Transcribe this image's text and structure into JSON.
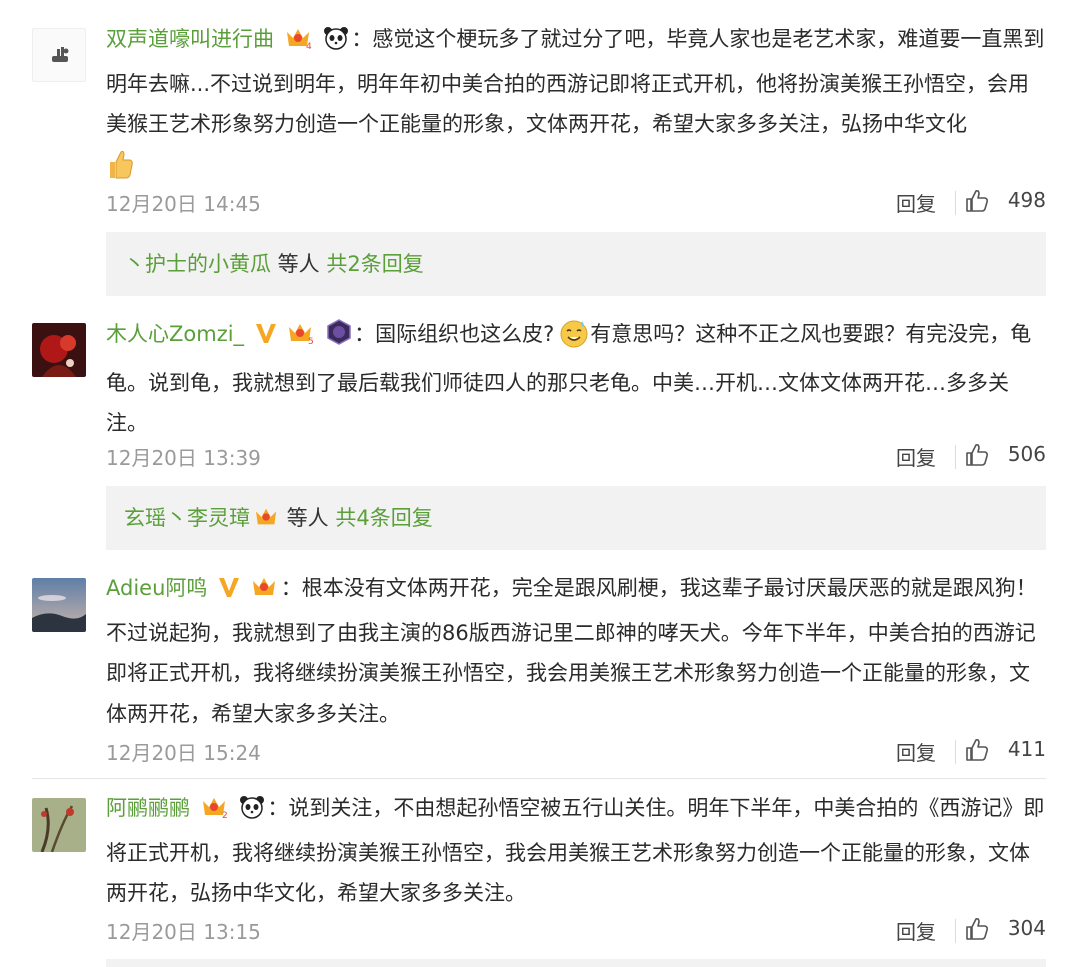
{
  "comments": [
    {
      "user": "双声道嚎叫进行曲",
      "badges": [
        "crown-lv4-icon",
        "panda-icon"
      ],
      "text": "感觉这个梗玩多了就过分了吧，毕竟人家也是老艺术家，难道要一直黑到明年去嘛...不过说到明年，明年年初中美合拍的西游记即将正式开机，他将扮演美猴王孙悟空，会用美猴王艺术形象努力创造一个正能量的形象，文体两开花，希望大家多多关注，弘扬中华文化",
      "emoji": "thumbs-up-icon",
      "time": "12月20日 14:45",
      "reply_label": "回复",
      "likes": "498",
      "replies": {
        "prefix": "丶护士的小黄瓜",
        "middle": " 等人 ",
        "count": "共2条回复"
      }
    },
    {
      "user": "木人心Zomzi_",
      "badges": [
        "verified-v-icon",
        "crown-lv5-icon",
        "night-badge-icon"
      ],
      "text_a": "国际组织也这么皮?",
      "text_b": "有意思吗？这种不正之风也要跟？有完没完，龟龟。说到龟，我就想到了最后载我们师徒四人的那只老龟。中美…开机…文体文体两开花…多多关注。",
      "emoji": "sweat-smile-icon",
      "time": "12月20日 13:39",
      "reply_label": "回复",
      "likes": "506",
      "replies": {
        "prefix": "玄瑶丶李灵璋",
        "middle": " 等人 ",
        "count": "共4条回复"
      }
    },
    {
      "user": "Adieu阿鸣",
      "badges": [
        "verified-v-icon",
        "crown-icon"
      ],
      "text": "根本没有文体两开花，完全是跟风刷梗，我这辈子最讨厌最厌恶的就是跟风狗！不过说起狗，我就想到了由我主演的86版西游记里二郎神的哮天犬。今年下半年，中美合拍的西游记即将正式开机，我将继续扮演美猴王孙悟空，我会用美猴王艺术形象努力创造一个正能量的形象，文体两开花，希望大家多多关注。",
      "time": "12月20日 15:24",
      "reply_label": "回复",
      "likes": "411"
    },
    {
      "user": "阿鹂鹂鹂",
      "badges": [
        "crown-lv2-icon",
        "panda-icon"
      ],
      "text": "说到关注，不由想起孙悟空被五行山关住。明年下半年，中美合拍的《西游记》即将正式开机，我将继续扮演美猴王孙悟空，我会用美猴王艺术形象努力创造一个正能量的形象，文体两开花，弘扬中华文化，希望大家多多关注。",
      "time": "12月20日 13:15",
      "reply_label": "回复",
      "likes": "304"
    }
  ],
  "colors": {
    "username": "#5a9f3a",
    "text": "#2b2b2b",
    "meta": "#9a9a9a",
    "reply_bg": "#f2f2f2"
  }
}
